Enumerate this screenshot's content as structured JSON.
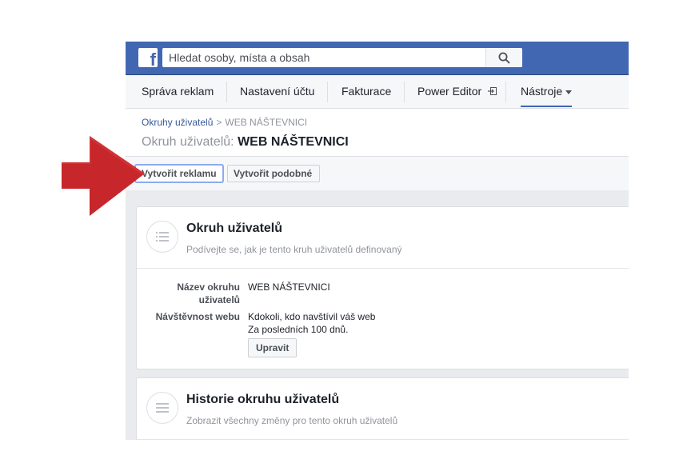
{
  "colors": {
    "brand_blue": "#4267b2",
    "arrow_red": "#c7272b",
    "link_blue": "#365899"
  },
  "search": {
    "placeholder": "Hledat osoby, místa a obsah",
    "icon": "search-icon"
  },
  "nav": {
    "items": [
      {
        "label": "Správa reklam"
      },
      {
        "label": "Nastavení účtu"
      },
      {
        "label": "Fakturace"
      },
      {
        "label": "Power Editor"
      },
      {
        "label": "Nástroje"
      }
    ]
  },
  "breadcrumb": {
    "parent": "Okruhy uživatelů",
    "current": "WEB NÁŠTEVNICI"
  },
  "page_title": {
    "prefix": "Okruh uživatelů:",
    "name": "WEB NÁŠTEVNICI"
  },
  "actions": {
    "create_ad": "Vytvořit reklamu",
    "create_similar": "Vytvořit podobné"
  },
  "audience_card": {
    "title": "Okruh uživatelů",
    "subtitle": "Podívejte se, jak je tento kruh uživatelů definovaný",
    "name_label_line1": "Název okruhu",
    "name_label_line2": "uživatelů",
    "name_value": "WEB NÁŠTEVNICI",
    "traffic_label": "Návštěvnost webu",
    "traffic_value_line1": "Kdokoli, kdo navštívil váš web",
    "traffic_value_line2": "Za posledních 100 dnů.",
    "edit_button": "Upravit"
  },
  "history_card": {
    "title": "Historie okruhu uživatelů",
    "subtitle": "Zobrazit všechny změny pro tento okruh uživatelů"
  }
}
